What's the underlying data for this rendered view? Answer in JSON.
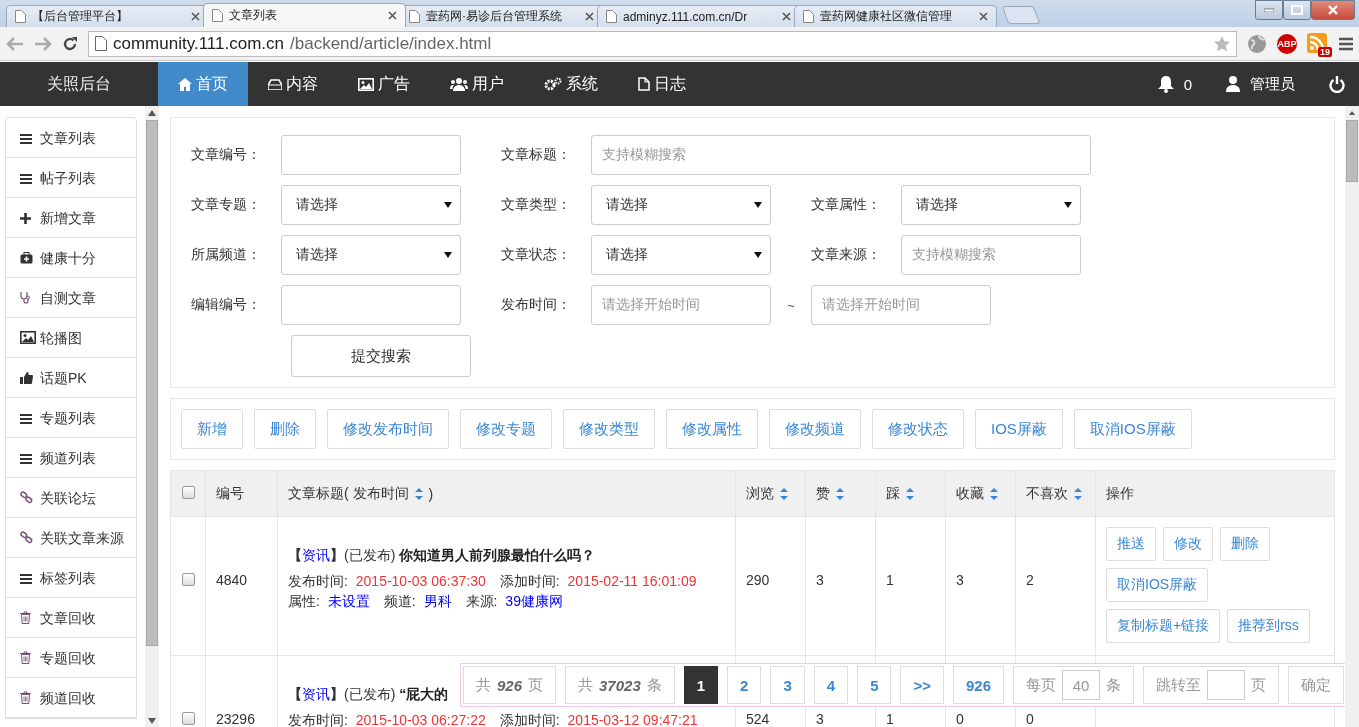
{
  "browser": {
    "tabs": [
      {
        "title": "【后台管理平台】",
        "selected": false
      },
      {
        "title": "文章列表",
        "selected": true
      },
      {
        "title": "壹药网·易诊后台管理系统",
        "selected": false
      },
      {
        "title": "adminyz.111.com.cn/Dr",
        "selected": false
      },
      {
        "title": "壹药网健康社区微信管理",
        "selected": false
      }
    ],
    "address": {
      "host": "community.111.com.cn",
      "path": "/backend/article/index.html"
    },
    "extension_label": "ABP",
    "feed_count": "19"
  },
  "navbar": {
    "brand": "关照后台",
    "items": [
      {
        "label": "首页",
        "kind": "home",
        "selected": true
      },
      {
        "label": "内容",
        "kind": "drive",
        "selected": false
      },
      {
        "label": "广告",
        "kind": "image",
        "selected": false
      },
      {
        "label": "用户",
        "kind": "users",
        "selected": false
      },
      {
        "label": "系统",
        "kind": "gears",
        "selected": false
      },
      {
        "label": "日志",
        "kind": "file",
        "selected": false
      }
    ],
    "notifications": "0",
    "user": "管理员"
  },
  "sidebar": {
    "items": [
      {
        "label": "文章列表",
        "kind": "list"
      },
      {
        "label": "帖子列表",
        "kind": "list"
      },
      {
        "label": "新增文章",
        "kind": "add"
      },
      {
        "label": "健康十分",
        "kind": "medkit"
      },
      {
        "label": "自测文章",
        "kind": "stethoscope"
      },
      {
        "label": "轮播图",
        "kind": "image"
      },
      {
        "label": "话题PK",
        "kind": "thumb"
      },
      {
        "label": "专题列表",
        "kind": "list"
      },
      {
        "label": "频道列表",
        "kind": "list"
      },
      {
        "label": "关联论坛",
        "kind": "link"
      },
      {
        "label": "关联文章来源",
        "kind": "link"
      },
      {
        "label": "标签列表",
        "kind": "list"
      },
      {
        "label": "文章回收",
        "kind": "trash"
      },
      {
        "label": "专题回收",
        "kind": "trash"
      },
      {
        "label": "频道回收",
        "kind": "trash"
      }
    ]
  },
  "search": {
    "rows": [
      [
        {
          "label": "文章编号：",
          "kind": "input"
        },
        {
          "label": "文章标题：",
          "kind": "input",
          "placeholder": "支持模糊搜索"
        }
      ],
      [
        {
          "label": "文章专题：",
          "kind": "select",
          "value": "请选择"
        },
        {
          "label": "文章类型：",
          "kind": "select",
          "value": "请选择"
        },
        {
          "label": "文章属性：",
          "kind": "select",
          "value": "请选择"
        }
      ],
      [
        {
          "label": "所属频道：",
          "kind": "select",
          "value": "请选择"
        },
        {
          "label": "文章状态：",
          "kind": "select",
          "value": "请选择"
        },
        {
          "label": "文章来源：",
          "kind": "input",
          "placeholder": "支持模糊搜索"
        }
      ],
      [
        {
          "label": "编辑编号：",
          "kind": "input"
        },
        {
          "label": "发布时间：",
          "kind": "range",
          "placeholder": "请选择开始时间",
          "separator": "~",
          "placeholder_end": "请选择开始时间"
        }
      ]
    ],
    "submit": "提交搜索"
  },
  "toolbar": [
    "新增",
    "删除",
    "修改发布时间",
    "修改专题",
    "修改类型",
    "修改属性",
    "修改频道",
    "修改状态",
    "IOS屏蔽",
    "取消IOS屏蔽"
  ],
  "table": {
    "select_all": {
      "checked": false
    },
    "columns": [
      {
        "label": "编号",
        "sortable": false
      },
      {
        "label": "文章标题( 发布时间",
        "sortable": true,
        "suffix": ")"
      },
      {
        "label": "浏览",
        "sortable": true
      },
      {
        "label": "赞",
        "sortable": true
      },
      {
        "label": "踩",
        "sortable": true
      },
      {
        "label": "收藏",
        "sortable": true
      },
      {
        "label": "不喜欢",
        "sortable": true
      },
      {
        "label": "操作",
        "sortable": false
      }
    ],
    "rows": [
      {
        "checked": false,
        "id": "4840",
        "category_brackets": [
          "【",
          "】"
        ],
        "category": "资讯",
        "status": "(已发布)",
        "title": "你知道男人前列腺最怕什么吗？",
        "publish_label": "发布时间:",
        "publish_time": "2015-10-03 06:37:30",
        "add_label": "添加时间:",
        "add_time": "2015-02-11 16:01:09",
        "attr_label": "属性:",
        "attr": "未设置",
        "channel_label": "频道:",
        "channel": "男科",
        "source_label": "来源:",
        "source": "39健康网",
        "views": "290",
        "likes": "3",
        "dislikes": "1",
        "favorites": "3",
        "unlikes": "2",
        "actions": [
          "推送",
          "修改",
          "删除",
          "取消IOS屏蔽",
          "复制标题+链接",
          "推荐到rss"
        ]
      },
      {
        "checked": false,
        "id": "23296",
        "category_brackets": [
          "【",
          "】"
        ],
        "category": "资讯",
        "status": "(已发布)",
        "title": "“屁大的",
        "publish_label": "发布时间:",
        "publish_time": "2015-10-03 06:27:22",
        "add_label": "添加时间:",
        "add_time": "2015-03-12 09:47:21",
        "views": "524",
        "likes": "3",
        "dislikes": "1",
        "favorites": "0",
        "unlikes": "0",
        "actions": []
      }
    ]
  },
  "pager": {
    "total_pages": "共 **926** 页",
    "total_items": "共 **37023** 条",
    "pages": [
      {
        "label": "1",
        "selected": true
      },
      {
        "label": "2",
        "selected": false
      },
      {
        "label": "3",
        "selected": false
      },
      {
        "label": "4",
        "selected": false
      },
      {
        "label": "5",
        "selected": false
      },
      {
        "label": ">>",
        "selected": false
      },
      {
        "label": "926",
        "selected": false
      }
    ],
    "per_page_label": "每页",
    "per_page": "40",
    "per_page_unit": "条",
    "jump_label": "跳转至",
    "jump_unit": "页",
    "confirm": "确定"
  }
}
